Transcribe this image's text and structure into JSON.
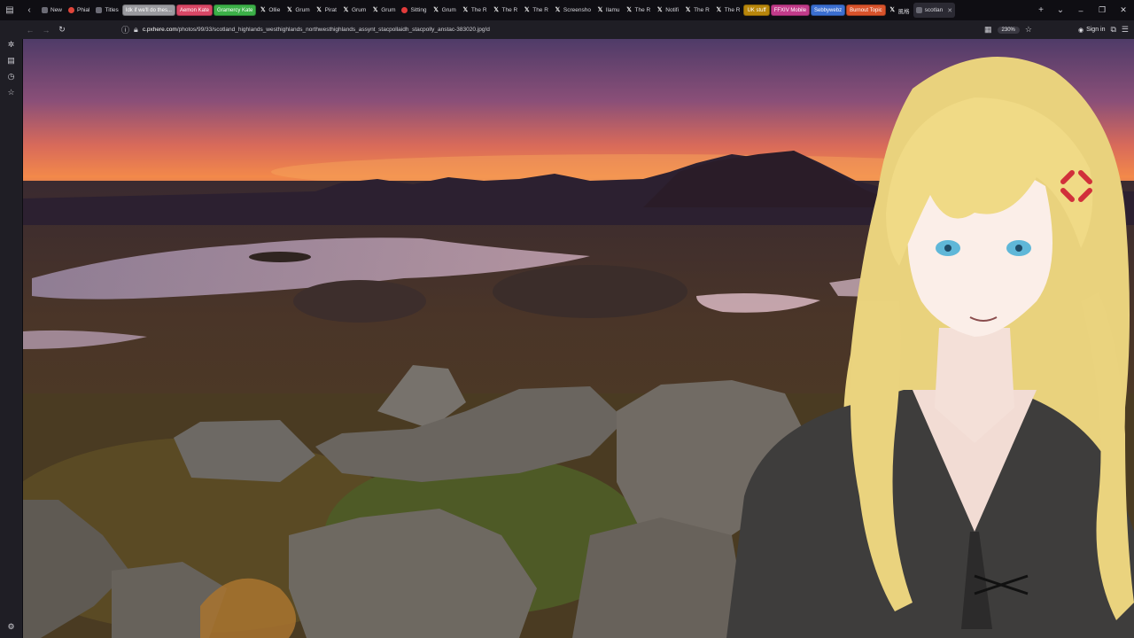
{
  "browser": {
    "tabs": [
      {
        "label": "New",
        "favicon": "new-tab-icon",
        "kind": "gen"
      },
      {
        "label": "Phial",
        "favicon": "reddit-icon",
        "kind": "red"
      },
      {
        "label": "Titles",
        "favicon": "page-icon",
        "kind": "gen"
      },
      {
        "label": "Idk if we'll do thes...",
        "kind": "group",
        "color": "#9a9a9f"
      },
      {
        "label": "Aemon Kate",
        "kind": "group",
        "color": "#d94766"
      },
      {
        "label": "Gramercy Kate",
        "kind": "group",
        "color": "#3cb048"
      },
      {
        "label": "Ollie",
        "favicon": "x-icon",
        "kind": "x"
      },
      {
        "label": "Grum",
        "favicon": "x-icon",
        "kind": "x"
      },
      {
        "label": "Pirat",
        "favicon": "x-icon",
        "kind": "x"
      },
      {
        "label": "Grum",
        "favicon": "x-icon",
        "kind": "x"
      },
      {
        "label": "Grum",
        "favicon": "x-icon",
        "kind": "x"
      },
      {
        "label": "Sitting",
        "favicon": "youtube-icon",
        "kind": "yt"
      },
      {
        "label": "Grum",
        "favicon": "x-icon",
        "kind": "x"
      },
      {
        "label": "The R",
        "favicon": "x-icon",
        "kind": "x"
      },
      {
        "label": "The R",
        "favicon": "x-icon",
        "kind": "x"
      },
      {
        "label": "The R",
        "favicon": "x-icon",
        "kind": "x"
      },
      {
        "label": "Screensho",
        "favicon": "x-icon",
        "kind": "x"
      },
      {
        "label": "llamu",
        "favicon": "x-icon",
        "kind": "x"
      },
      {
        "label": "The R",
        "favicon": "x-icon",
        "kind": "x"
      },
      {
        "label": "Notifi",
        "favicon": "x-icon",
        "kind": "x"
      },
      {
        "label": "The R",
        "favicon": "x-icon",
        "kind": "x"
      },
      {
        "label": "The R",
        "favicon": "x-icon",
        "kind": "x"
      },
      {
        "label": "UK stuff",
        "kind": "group",
        "color": "#b8860b"
      },
      {
        "label": "FFXIV Mobile",
        "kind": "group",
        "color": "#c23b8a"
      },
      {
        "label": "Sebbywebz",
        "kind": "group",
        "color": "#3b6fd1"
      },
      {
        "label": "Burnout Topic",
        "kind": "group",
        "color": "#d9532b"
      },
      {
        "label": "風格",
        "favicon": "x-icon",
        "kind": "x"
      },
      {
        "label": "scotlan",
        "favicon": "page-icon",
        "kind": "active"
      }
    ],
    "url": {
      "host": "c.pxhere.com",
      "path": "/photos/99/33/scotland_highlands_westhighlands_northwesthighlands_assynt_stacpollaidh_stacpolly_anstac-383020.jpg!d"
    },
    "zoom": "230%",
    "sign_in": "Sign in"
  },
  "colors": {
    "tab_bg": "#0f0e13",
    "toolbar_bg": "#1f1e25",
    "sky_top": "#4a3a63",
    "sky_horizon": "#f07a3a"
  }
}
